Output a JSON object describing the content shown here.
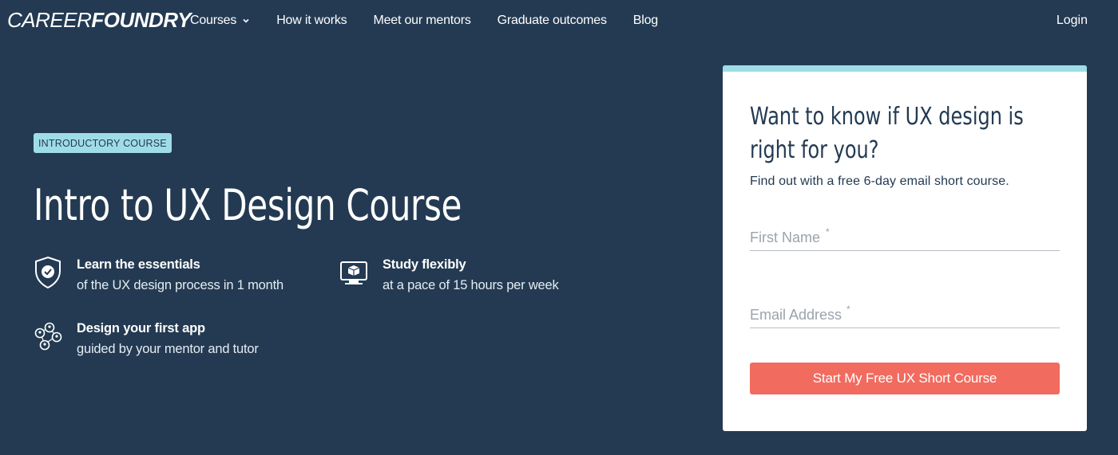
{
  "brand": {
    "logo_light": "CAREER",
    "logo_bold": "FOUNDRY"
  },
  "nav": {
    "items": [
      {
        "label": "Courses",
        "has_dropdown": true
      },
      {
        "label": "How it works"
      },
      {
        "label": "Meet our mentors"
      },
      {
        "label": "Graduate outcomes"
      },
      {
        "label": "Blog"
      }
    ],
    "login": "Login"
  },
  "hero": {
    "badge": "INTRODUCTORY COURSE",
    "title": "Intro to UX Design Course",
    "features": [
      {
        "icon": "shield-check-icon",
        "heading": "Learn the essentials",
        "sub": "of the UX design process in 1 month"
      },
      {
        "icon": "monitor-box-icon",
        "heading": "Study flexibly",
        "sub": "at a pace of 15 hours per week"
      },
      {
        "icon": "people-network-icon",
        "heading": "Design your first app",
        "sub": "guided by your mentor and tutor"
      }
    ]
  },
  "form": {
    "title": "Want to know if UX design is right for you?",
    "subtitle": "Find out with a free 6-day email short course.",
    "first_name_placeholder": "First Name",
    "email_placeholder": "Email Address",
    "required_mark": "*",
    "submit_label": "Start My Free UX Short Course"
  },
  "colors": {
    "background": "#233a52",
    "accent_teal": "#9fdde6",
    "cta_coral": "#f26b5f",
    "card": "#ffffff"
  }
}
